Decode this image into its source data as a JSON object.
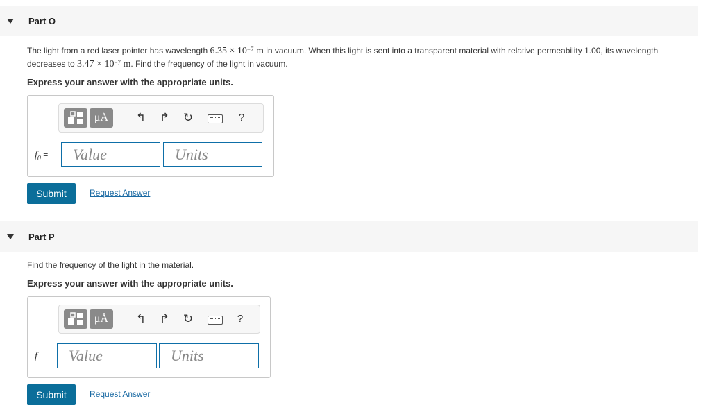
{
  "partO": {
    "title": "Part O",
    "question_before": "The light from a red laser pointer has wavelength ",
    "wl_vac_mantissa": "6.35 × 10",
    "wl_vac_exp": "−7",
    "wl_unit": " m",
    "question_mid": " in vacuum. When this light is sent into a transparent material with relative permeability 1.00, its wavelength decreases to ",
    "wl_mat_mantissa": "3.47 × 10",
    "wl_mat_exp": "−7",
    "question_after": ". Find the frequency of the light in vacuum.",
    "express": "Express your answer with the appropriate units.",
    "var_base": "f",
    "var_sub": "0",
    "var_eq": " =",
    "value_placeholder": "Value",
    "units_placeholder": "Units",
    "submit_label": "Submit",
    "request_label": "Request Answer"
  },
  "partP": {
    "title": "Part P",
    "question": "Find the frequency of the light in the material.",
    "express": "Express your answer with the appropriate units.",
    "var_base": "f",
    "var_eq": " =",
    "value_placeholder": "Value",
    "units_placeholder": "Units",
    "submit_label": "Submit",
    "request_label": "Request Answer"
  },
  "toolbar": {
    "units_button_label": "μÅ",
    "help_label": "?",
    "icons": [
      "templates-icon",
      "units-icon",
      "undo-icon",
      "redo-icon",
      "reset-icon",
      "keyboard-icon",
      "help-icon"
    ]
  },
  "colors": {
    "accent": "#0b6e9a",
    "link": "#1a6aa3",
    "field_border": "#0e6fa8",
    "header_bg": "#f6f6f6"
  }
}
